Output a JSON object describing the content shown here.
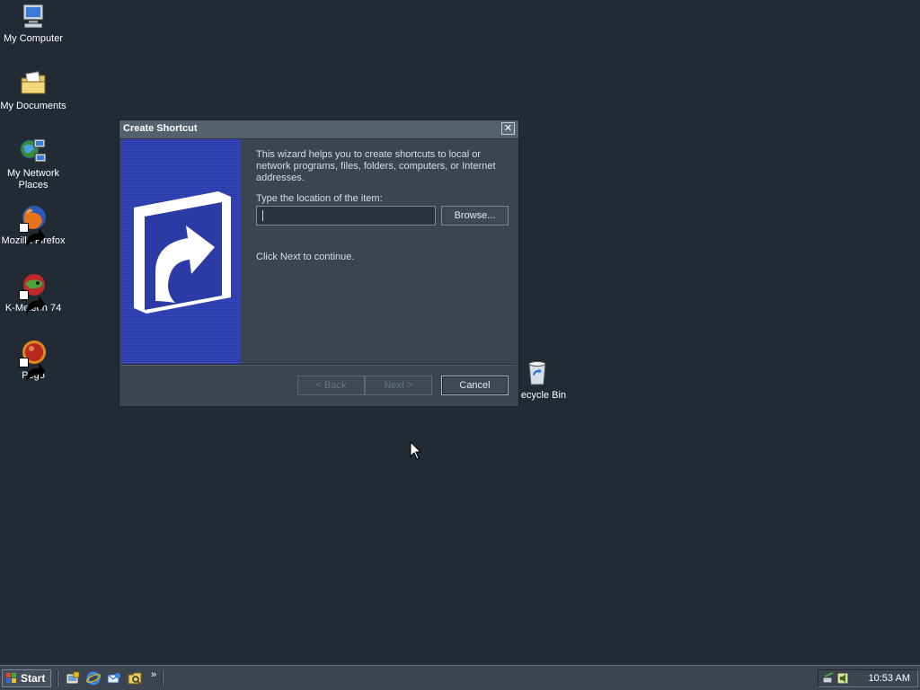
{
  "desktop": {
    "icons": [
      {
        "label": "My Computer",
        "icon": "computer-icon"
      },
      {
        "label": "My Documents",
        "icon": "documents-folder-icon"
      },
      {
        "label": "My Network Places",
        "icon": "network-places-icon"
      },
      {
        "label": "Mozilla Firefox",
        "icon": "firefox-icon"
      },
      {
        "label": "K-Meleon 74",
        "icon": "kmeleon-icon"
      },
      {
        "label": "Pego",
        "icon": "pego-icon"
      },
      {
        "label": "ecycle Bin",
        "icon": "recycle-bin-icon"
      }
    ]
  },
  "dialog": {
    "title": "Create Shortcut",
    "close_label": "✕",
    "intro": "This wizard helps you to create shortcuts to local or network programs, files, folders, computers, or Internet addresses.",
    "location_label": "Type the location of the item:",
    "location_value": "",
    "browse_label": "Browse...",
    "continue_text": "Click Next to continue.",
    "back_label": "< Back",
    "next_label": "Next >",
    "cancel_label": "Cancel"
  },
  "taskbar": {
    "start_label": "Start",
    "quick_launch": [
      "show-desktop-icon",
      "internet-explorer-icon",
      "outlook-express-icon",
      "explorer-icon"
    ],
    "chevron": "»",
    "clock": "10:53 AM"
  },
  "colors": {
    "desktop": "#222a33",
    "dialog_bg": "#3b4450",
    "wizard_banner": "#2b3aa5"
  }
}
